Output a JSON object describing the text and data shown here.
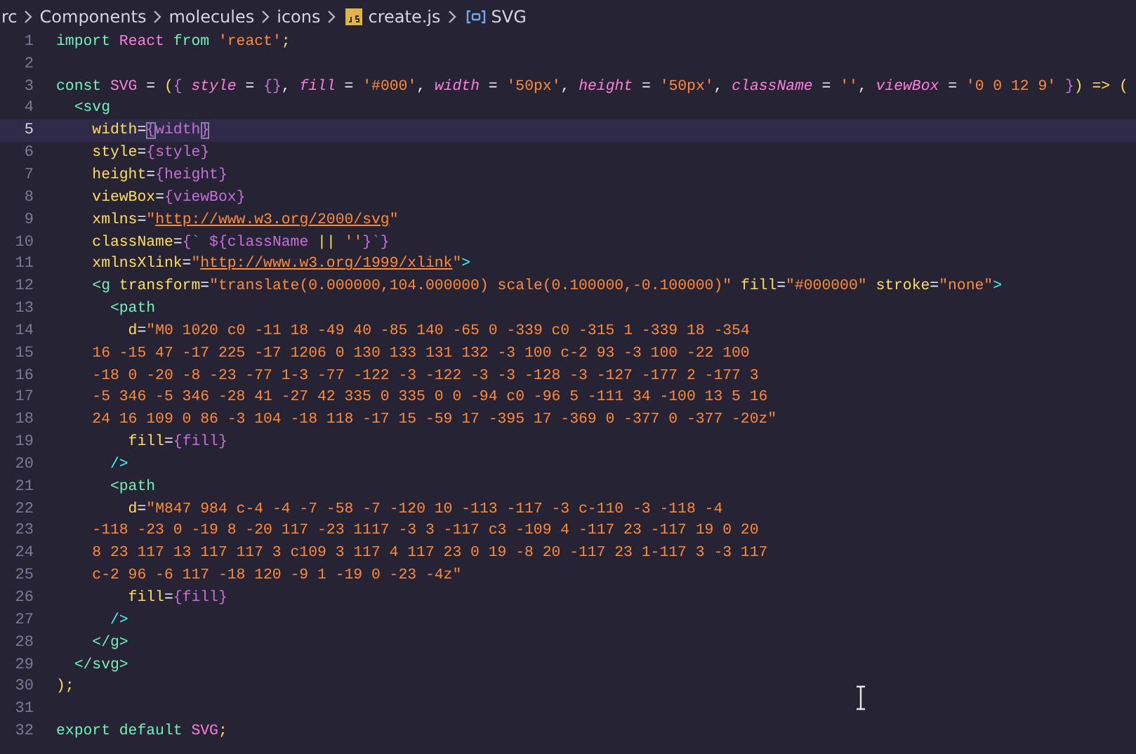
{
  "breadcrumb": [
    {
      "label": "rc"
    },
    {
      "label": "Components"
    },
    {
      "label": "molecules"
    },
    {
      "label": "icons"
    },
    {
      "label": "create.js",
      "kind": "js"
    },
    {
      "label": "SVG",
      "kind": "symbol"
    }
  ],
  "editor": {
    "lines": [
      {
        "number": "1",
        "current": false,
        "tokens": [
          {
            "kind": "kw",
            "text": "import "
          },
          {
            "kind": "ident",
            "text": "React"
          },
          {
            "kind": "kw",
            "text": " from "
          },
          {
            "kind": "str",
            "text": "'react'"
          },
          {
            "kind": "punc",
            "text": ";"
          }
        ]
      },
      {
        "number": "2",
        "current": false
      },
      {
        "number": "3",
        "current": false,
        "tokens": [
          {
            "kind": "kw",
            "text": "const "
          },
          {
            "kind": "ident",
            "text": "SVG"
          },
          {
            "kind": "plain",
            "text": " = "
          },
          {
            "kind": "punc",
            "text": "("
          },
          {
            "kind": "brace",
            "text": "{ "
          },
          {
            "kind": "param",
            "text": "style"
          },
          {
            "kind": "plain",
            "text": " = "
          },
          {
            "kind": "brace",
            "text": "{}"
          },
          {
            "kind": "plain",
            "text": ", "
          },
          {
            "kind": "param",
            "text": "fill"
          },
          {
            "kind": "plain",
            "text": " = "
          },
          {
            "kind": "str",
            "text": "'#000'"
          },
          {
            "kind": "plain",
            "text": ", "
          },
          {
            "kind": "param",
            "text": "width"
          },
          {
            "kind": "plain",
            "text": " = "
          },
          {
            "kind": "str",
            "text": "'50px'"
          },
          {
            "kind": "plain",
            "text": ", "
          },
          {
            "kind": "param",
            "text": "height"
          },
          {
            "kind": "plain",
            "text": " = "
          },
          {
            "kind": "str",
            "text": "'50px'"
          },
          {
            "kind": "plain",
            "text": ", "
          },
          {
            "kind": "param",
            "text": "className"
          },
          {
            "kind": "plain",
            "text": " = "
          },
          {
            "kind": "str",
            "text": "''"
          },
          {
            "kind": "plain",
            "text": ", "
          },
          {
            "kind": "param",
            "text": "viewBox"
          },
          {
            "kind": "plain",
            "text": " = "
          },
          {
            "kind": "str",
            "text": "'0 0 12 9' "
          },
          {
            "kind": "brace",
            "text": "}"
          },
          {
            "kind": "punc",
            "text": ") => ("
          }
        ]
      },
      {
        "number": "4",
        "current": false,
        "tokens": [
          {
            "kind": "tag",
            "text": "  <svg"
          }
        ]
      },
      {
        "number": "5",
        "current": true,
        "tokens": [
          {
            "kind": "attr",
            "text": "    width"
          },
          {
            "kind": "plain",
            "text": "="
          },
          {
            "kind": "match",
            "text": "{"
          },
          {
            "kind": "var",
            "text": "width"
          },
          {
            "kind": "match",
            "text": "}"
          }
        ]
      },
      {
        "number": "6",
        "current": false,
        "tokens": [
          {
            "kind": "attr",
            "text": "    style"
          },
          {
            "kind": "plain",
            "text": "="
          },
          {
            "kind": "brace",
            "text": "{"
          },
          {
            "kind": "var",
            "text": "style"
          },
          {
            "kind": "brace",
            "text": "}"
          }
        ]
      },
      {
        "number": "7",
        "current": false,
        "tokens": [
          {
            "kind": "attr",
            "text": "    height"
          },
          {
            "kind": "plain",
            "text": "="
          },
          {
            "kind": "brace",
            "text": "{"
          },
          {
            "kind": "var",
            "text": "height"
          },
          {
            "kind": "brace",
            "text": "}"
          }
        ]
      },
      {
        "number": "8",
        "current": false,
        "tokens": [
          {
            "kind": "attr",
            "text": "    viewBox"
          },
          {
            "kind": "plain",
            "text": "="
          },
          {
            "kind": "brace",
            "text": "{"
          },
          {
            "kind": "var",
            "text": "viewBox"
          },
          {
            "kind": "brace",
            "text": "}"
          }
        ]
      },
      {
        "number": "9",
        "current": false,
        "tokens": [
          {
            "kind": "attr",
            "text": "    xmlns"
          },
          {
            "kind": "plain",
            "text": "="
          },
          {
            "kind": "str",
            "text": "\""
          },
          {
            "kind": "link",
            "text": "http://www.w3.org/2000/svg"
          },
          {
            "kind": "str",
            "text": "\""
          }
        ]
      },
      {
        "number": "10",
        "current": false,
        "tokens": [
          {
            "kind": "attr",
            "text": "    className"
          },
          {
            "kind": "plain",
            "text": "="
          },
          {
            "kind": "brace",
            "text": "{` ${"
          },
          {
            "kind": "var",
            "text": "className"
          },
          {
            "kind": "punc",
            "text": " || "
          },
          {
            "kind": "str",
            "text": "''"
          },
          {
            "kind": "brace",
            "text": "}`}"
          }
        ]
      },
      {
        "number": "11",
        "current": false,
        "tokens": [
          {
            "kind": "attr",
            "text": "    xmlnsXlink"
          },
          {
            "kind": "plain",
            "text": "="
          },
          {
            "kind": "str",
            "text": "\""
          },
          {
            "kind": "link",
            "text": "http://www.w3.org/1999/xlink"
          },
          {
            "kind": "str",
            "text": "\""
          },
          {
            "kind": "close",
            "text": ">"
          }
        ]
      },
      {
        "number": "12",
        "current": false,
        "tokens": [
          {
            "kind": "tag",
            "text": "    <g "
          },
          {
            "kind": "attr",
            "text": "transform"
          },
          {
            "kind": "plain",
            "text": "="
          },
          {
            "kind": "str",
            "text": "\"translate(0.000000,104.000000) scale(0.100000,-0.100000)\" "
          },
          {
            "kind": "attr",
            "text": "fill"
          },
          {
            "kind": "plain",
            "text": "="
          },
          {
            "kind": "str",
            "text": "\"#000000\" "
          },
          {
            "kind": "attr",
            "text": "stroke"
          },
          {
            "kind": "plain",
            "text": "="
          },
          {
            "kind": "str",
            "text": "\"none\""
          },
          {
            "kind": "close",
            "text": ">"
          }
        ]
      },
      {
        "number": "13",
        "current": false,
        "tokens": [
          {
            "kind": "tag",
            "text": "      <path"
          }
        ]
      },
      {
        "number": "14",
        "current": false,
        "tokens": [
          {
            "kind": "attr",
            "text": "        d"
          },
          {
            "kind": "plain",
            "text": "="
          },
          {
            "kind": "str",
            "text": "\"M0 1020 c0 -11 18 -49 40 -85 140 -65 0 -339 c0 -315 1 -339 18 -354"
          }
        ]
      },
      {
        "number": "15",
        "current": false,
        "tokens": [
          {
            "kind": "str",
            "text": "    16 -15 47 -17 225 -17 1206 0 130 133 131 132 -3 100 c-2 93 -3 100 -22 100"
          }
        ]
      },
      {
        "number": "16",
        "current": false,
        "tokens": [
          {
            "kind": "str",
            "text": "    -18 0 -20 -8 -23 -77 1-3 -77 -122 -3 -122 -3 -3 -128 -3 -127 -177 2 -177 3"
          }
        ]
      },
      {
        "number": "17",
        "current": false,
        "tokens": [
          {
            "kind": "str",
            "text": "    -5 346 -5 346 -28 41 -27 42 335 0 335 0 0 -94 c0 -96 5 -111 34 -100 13 5 16"
          }
        ]
      },
      {
        "number": "18",
        "current": false,
        "tokens": [
          {
            "kind": "str",
            "text": "    24 16 109 0 86 -3 104 -18 118 -17 15 -59 17 -395 17 -369 0 -377 0 -377 -20z\""
          }
        ]
      },
      {
        "number": "19",
        "current": false,
        "tokens": [
          {
            "kind": "attr",
            "text": "        fill"
          },
          {
            "kind": "plain",
            "text": "="
          },
          {
            "kind": "brace",
            "text": "{"
          },
          {
            "kind": "var",
            "text": "fill"
          },
          {
            "kind": "brace",
            "text": "}"
          }
        ]
      },
      {
        "number": "20",
        "current": false,
        "tokens": [
          {
            "kind": "close",
            "text": "      />"
          }
        ]
      },
      {
        "number": "21",
        "current": false,
        "tokens": [
          {
            "kind": "tag",
            "text": "      <path"
          }
        ]
      },
      {
        "number": "22",
        "current": false,
        "tokens": [
          {
            "kind": "attr",
            "text": "        d"
          },
          {
            "kind": "plain",
            "text": "="
          },
          {
            "kind": "str",
            "text": "\"M847 984 c-4 -4 -7 -58 -7 -120 10 -113 -117 -3 c-110 -3 -118 -4"
          }
        ]
      },
      {
        "number": "23",
        "current": false,
        "tokens": [
          {
            "kind": "str",
            "text": "    -118 -23 0 -19 8 -20 117 -23 1117 -3 3 -117 c3 -109 4 -117 23 -117 19 0 20"
          }
        ]
      },
      {
        "number": "24",
        "current": false,
        "tokens": [
          {
            "kind": "str",
            "text": "    8 23 117 13 117 117 3 c109 3 117 4 117 23 0 19 -8 20 -117 23 1-117 3 -3 117"
          }
        ]
      },
      {
        "number": "25",
        "current": false,
        "tokens": [
          {
            "kind": "str",
            "text": "    c-2 96 -6 117 -18 120 -9 1 -19 0 -23 -4z\""
          }
        ]
      },
      {
        "number": "26",
        "current": false,
        "tokens": [
          {
            "kind": "attr",
            "text": "        fill"
          },
          {
            "kind": "plain",
            "text": "="
          },
          {
            "kind": "brace",
            "text": "{"
          },
          {
            "kind": "var",
            "text": "fill"
          },
          {
            "kind": "brace",
            "text": "}"
          }
        ]
      },
      {
        "number": "27",
        "current": false,
        "tokens": [
          {
            "kind": "close",
            "text": "      />"
          }
        ]
      },
      {
        "number": "28",
        "current": false,
        "tokens": [
          {
            "kind": "tag",
            "text": "    </g>"
          }
        ]
      },
      {
        "number": "29",
        "current": false,
        "tokens": [
          {
            "kind": "tag",
            "text": "  </svg>"
          }
        ]
      },
      {
        "number": "30",
        "current": false,
        "tokens": [
          {
            "kind": "punc",
            "text": ");"
          }
        ]
      },
      {
        "number": "31",
        "current": false
      },
      {
        "number": "32",
        "current": false,
        "tokens": [
          {
            "kind": "kw",
            "text": "export default "
          },
          {
            "kind": "ident",
            "text": "SVG"
          },
          {
            "kind": "punc",
            "text": ";"
          }
        ]
      }
    ]
  }
}
